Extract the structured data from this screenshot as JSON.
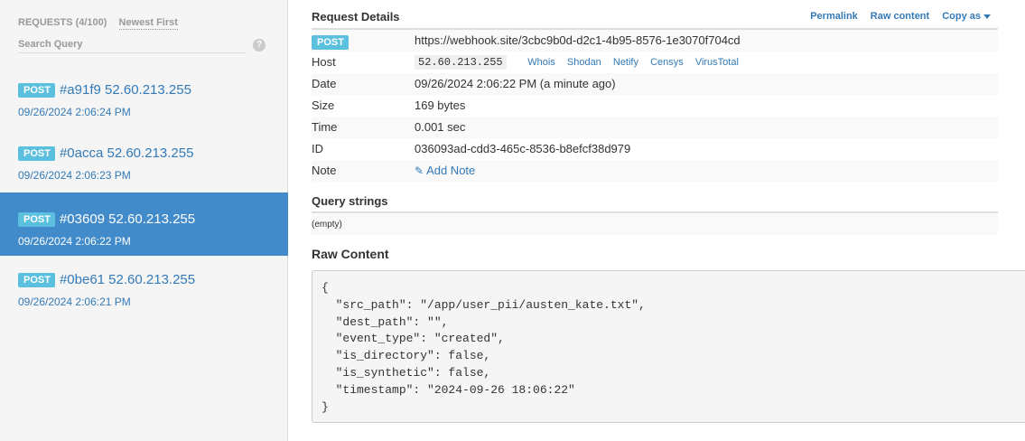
{
  "sidebar": {
    "requests_label": "REQUESTS",
    "requests_count": "(4/100)",
    "sort_label": "Newest First",
    "search_placeholder": "Search Query",
    "help_symbol": "?",
    "items": [
      {
        "method": "POST",
        "title": "#a91f9 52.60.213.255",
        "time": "09/26/2024 2:06:24 PM",
        "active": false
      },
      {
        "method": "POST",
        "title": "#0acca 52.60.213.255",
        "time": "09/26/2024 2:06:23 PM",
        "active": false
      },
      {
        "method": "POST",
        "title": "#03609 52.60.213.255",
        "time": "09/26/2024 2:06:22 PM",
        "active": true
      },
      {
        "method": "POST",
        "title": "#0be61 52.60.213.255",
        "time": "09/26/2024 2:06:21 PM",
        "active": false
      }
    ]
  },
  "details": {
    "title": "Request Details",
    "links": {
      "permalink": "Permalink",
      "raw_content": "Raw content",
      "copy_as": "Copy as"
    },
    "method": "POST",
    "url": "https://webhook.site/3cbc9b0d-d2c1-4b95-8576-1e3070f704cd",
    "host_label": "Host",
    "host_ip": "52.60.213.255",
    "host_links": [
      "Whois",
      "Shodan",
      "Netify",
      "Censys",
      "VirusTotal"
    ],
    "date_label": "Date",
    "date_value": "09/26/2024 2:06:22 PM (a minute ago)",
    "size_label": "Size",
    "size_value": "169 bytes",
    "time_label": "Time",
    "time_value": "0.001 sec",
    "id_label": "ID",
    "id_value": "036093ad-cdd3-465c-8536-b8efcf38d979",
    "note_label": "Note",
    "add_note": "Add Note"
  },
  "query_strings": {
    "title": "Query strings",
    "value": "(empty)"
  },
  "raw_content": {
    "title": "Raw Content",
    "body": "{\n  \"src_path\": \"/app/user_pii/austen_kate.txt\",\n  \"dest_path\": \"\",\n  \"event_type\": \"created\",\n  \"is_directory\": false,\n  \"is_synthetic\": false,\n  \"timestamp\": \"2024-09-26 18:06:22\"\n}"
  },
  "colors": {
    "accent": "#337ab7",
    "active_bg": "#428bca",
    "badge": "#5bc0de"
  }
}
